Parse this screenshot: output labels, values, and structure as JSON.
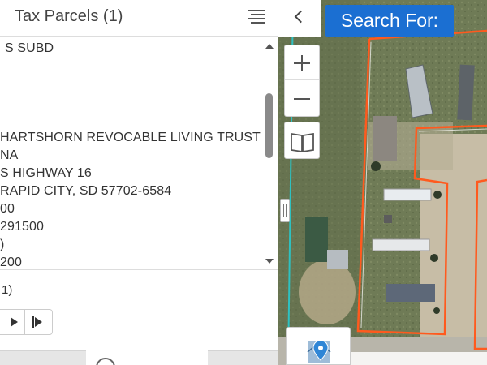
{
  "panel": {
    "title": "Tax Parcels (1)",
    "list_icon": "list-icon"
  },
  "details": {
    "lines": [
      "S SUBD",
      "",
      "",
      "",
      "HARTSHORN REVOCABLE LIVING TRUST",
      "NA",
      "S HIGHWAY 16",
      "RAPID CITY, SD 57702-6584",
      "00",
      " 291500",
      ")",
      "200"
    ]
  },
  "pager": {
    "count_text": "1)",
    "play_icon": "play-icon",
    "next_icon": "skip-next-icon"
  },
  "map": {
    "search_label": "Search For:",
    "collapse_icon": "chevron-left-icon",
    "zoom_in_icon": "plus-icon",
    "zoom_out_icon": "minus-icon",
    "bookmark_icon": "open-book-icon",
    "locate_icon": "map-pin-icon"
  },
  "colors": {
    "accent": "#1b6fd2",
    "parcel_outline": "#ff5a1e"
  }
}
